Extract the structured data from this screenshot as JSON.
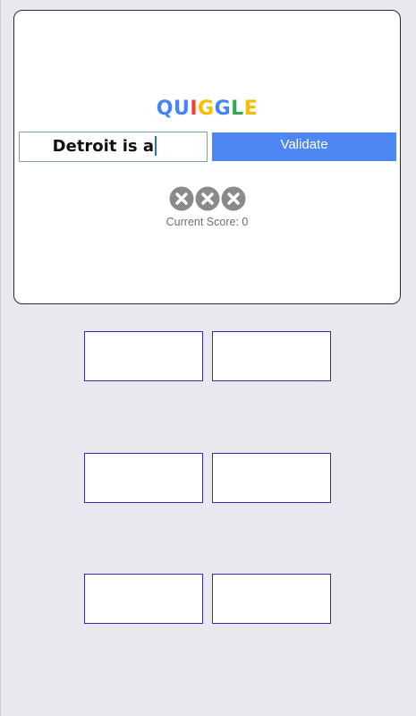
{
  "app": {
    "logo_letters": [
      {
        "char": "Q",
        "color": "#4285F4"
      },
      {
        "char": "U",
        "color": "#4285F4"
      },
      {
        "char": "I",
        "color": "#EA4335"
      },
      {
        "char": "G",
        "color": "#FBBC05"
      },
      {
        "char": "G",
        "color": "#4285F4"
      },
      {
        "char": "L",
        "color": "#34A853"
      },
      {
        "char": "E",
        "color": "#FBBC05"
      }
    ]
  },
  "input": {
    "value": "Detroit is a",
    "placeholder": ""
  },
  "validate_button": {
    "label": "Validate",
    "color": "#4E87F1"
  },
  "strikes": {
    "icon": "close-icon",
    "count": 3,
    "color": "#8A8A8A"
  },
  "score": {
    "label": "Current Score: 0"
  },
  "answer_tiles": [
    {
      "text": ""
    },
    {
      "text": ""
    },
    {
      "text": ""
    },
    {
      "text": ""
    },
    {
      "text": ""
    },
    {
      "text": ""
    }
  ]
}
